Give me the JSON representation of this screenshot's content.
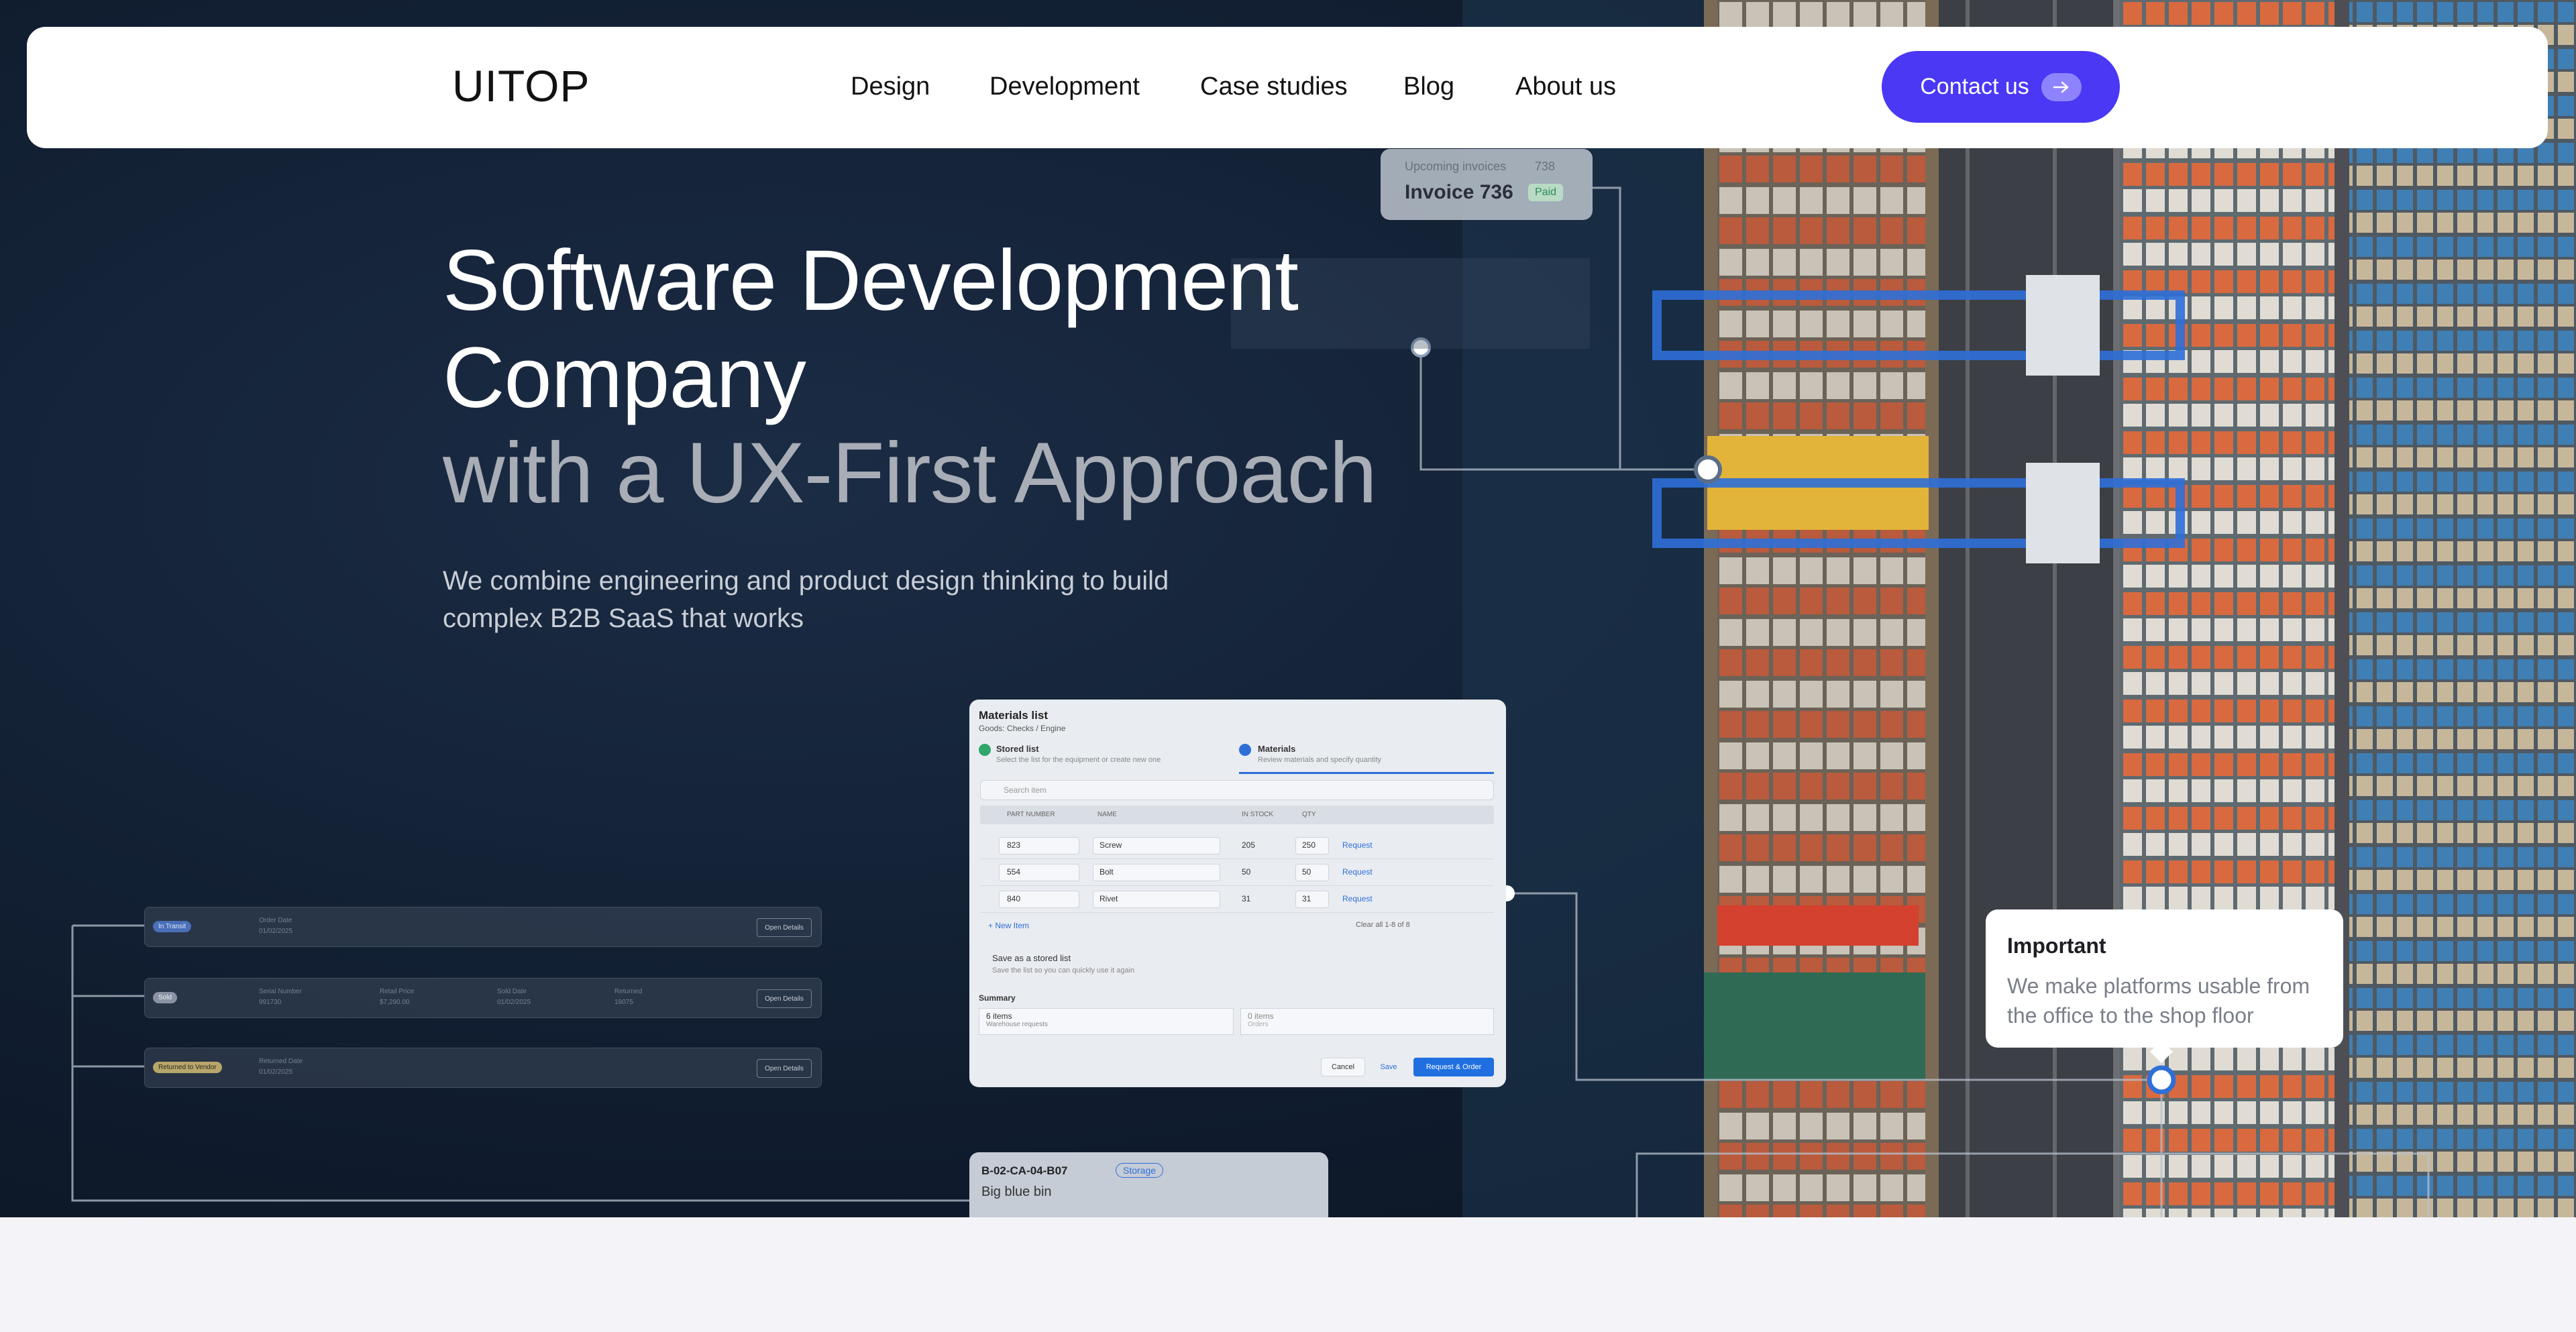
{
  "header": {
    "logo": "UITOP",
    "nav": [
      "Design",
      "Development",
      "Case studies",
      "Blog",
      "About us"
    ],
    "contact_label": "Contact us"
  },
  "hero": {
    "title_line1": "Software Development",
    "title_line2": "Company",
    "title_line3": "with a UX-First Approach",
    "subtitle_line1": "We combine engineering and product design thinking to build",
    "subtitle_line2": "complex B2B SaaS that works"
  },
  "invoice": {
    "label": "Upcoming invoices",
    "count": "738",
    "title": "Invoice 736",
    "status": "Paid"
  },
  "materials": {
    "title": "Materials list",
    "subtitle": "Goods: Checks / Engine",
    "step1_label": "Stored list",
    "step1_desc": "Select the list for the equipment or create new one",
    "step2_label": "Materials",
    "step2_desc": "Review materials and specify quantity",
    "search_placeholder": "Search item",
    "columns": [
      "PART NUMBER",
      "NAME",
      "IN STOCK",
      "QTY"
    ],
    "rows": [
      {
        "part": "823",
        "name": "Screw",
        "stock": "205",
        "qty": "250",
        "action": "Request"
      },
      {
        "part": "554",
        "name": "Bolt",
        "stock": "50",
        "qty": "50",
        "action": "Request"
      },
      {
        "part": "840",
        "name": "Rivet",
        "stock": "31",
        "qty": "31",
        "action": "Request"
      }
    ],
    "new_item": "+ New Item",
    "pager": "Clear all    1-8 of 8",
    "save_list": "Save as a stored list",
    "save_desc": "Save the list so you can quickly use it again",
    "summary": "Summary",
    "items_count": "6 items",
    "items_sub": "Warehouse requests",
    "items_right": "0 items",
    "items_right_sub": "Orders",
    "cancel": "Cancel",
    "save": "Save",
    "request_order": "Request & Order"
  },
  "ghost_rows": [
    {
      "tag": "In Transit",
      "col1_label": "Order Date",
      "col1_value": "01/02/2025",
      "action": "Open Details"
    },
    {
      "tag": "Sold",
      "col1_label": "Serial Number",
      "col1_value": "991730",
      "col2_label": "Retail Price",
      "col2_value": "$7,290.00",
      "col3_label": "Sold Date",
      "col3_value": "01/02/2025",
      "col4_label": "Returned",
      "col4_value": "19075",
      "action": "Open Details"
    },
    {
      "tag": "Returned to Vendor",
      "col1_label": "Returned Date",
      "col1_value": "01/02/2025",
      "action": "Open Details"
    }
  ],
  "important": {
    "title": "Important",
    "text": "We make platforms usable from the office to the shop floor"
  },
  "storage": {
    "code": "B-02-CA-04-B07",
    "tag": "Storage",
    "name": "Big blue bin"
  },
  "colors": {
    "accent": "#4a38f5",
    "hero_bg": "#0d1a2c",
    "header_bg": "#ffffff",
    "page_bg": "#f4f3f7"
  }
}
